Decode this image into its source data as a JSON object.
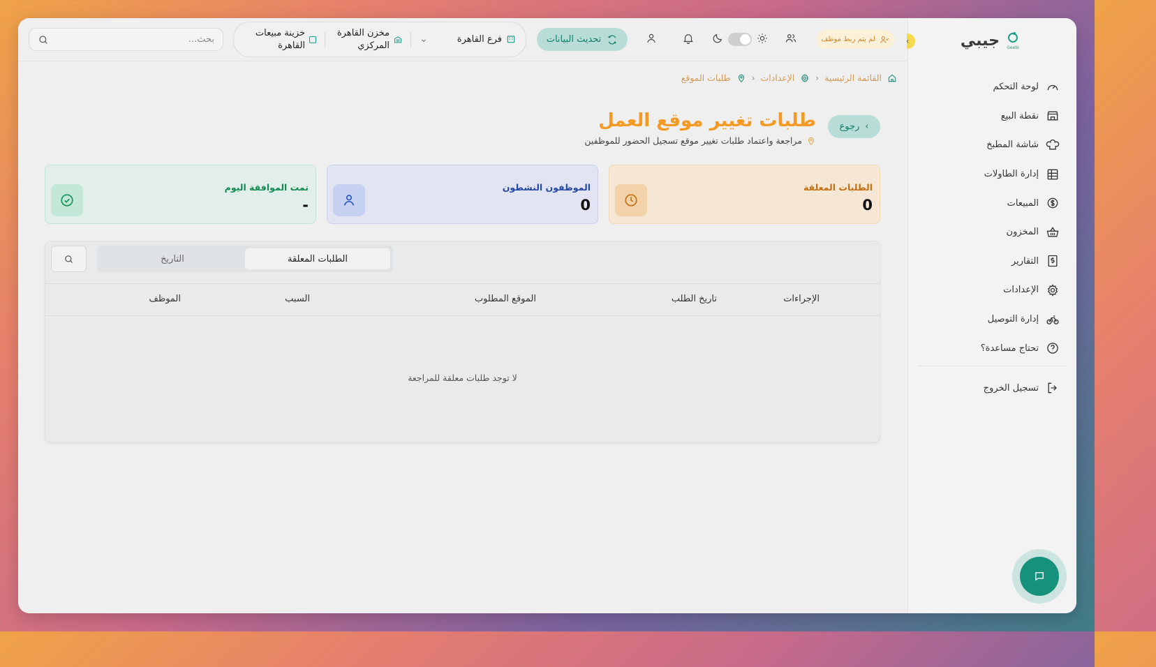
{
  "app": {
    "logo_text": "جيبي",
    "logo_sub": "Geebi"
  },
  "sidebar": {
    "items": [
      {
        "label": "لوحة التحكم",
        "icon": "gauge-icon"
      },
      {
        "label": "نقطة البيع",
        "icon": "store-icon"
      },
      {
        "label": "شاشة المطبخ",
        "icon": "chef-hat-icon"
      },
      {
        "label": "إدارة الطاولات",
        "icon": "table-grid-icon"
      },
      {
        "label": "المبيعات",
        "icon": "dollar-circle-icon"
      },
      {
        "label": "المخزون",
        "icon": "basket-icon"
      },
      {
        "label": "التقارير",
        "icon": "receipt-icon"
      },
      {
        "label": "الإعدادات",
        "icon": "gear-icon"
      },
      {
        "label": "إدارة التوصيل",
        "icon": "bicycle-icon"
      },
      {
        "label": "تحتاج مساعدة؟",
        "icon": "help-circle-icon"
      }
    ],
    "logout_label": "تسجيل الخروج"
  },
  "topbar": {
    "search_placeholder": "بحث...",
    "treasury_label": "خزينة مبيعات القاهرة",
    "warehouse_label": "مخزن القاهرة المركزي",
    "branch_label": "فرع القاهرة",
    "refresh_label": "تحديث البيانات",
    "unlinked_badge": "لم يتم ربط موظف"
  },
  "breadcrumb": {
    "home": "القائمة الرئيسية",
    "settings": "الإعدادات",
    "current": "طلبات الموقع"
  },
  "page": {
    "back_label": "رجوع",
    "title": "طلبات تغيير موقع العمل",
    "subtitle": "مراجعة واعتماد طلبات تغيير موقع تسجيل الحضور للموظفين"
  },
  "stats": {
    "pending": {
      "label": "الطلبات المعلقة",
      "value": "0"
    },
    "active": {
      "label": "الموظفون النشطون",
      "value": "0"
    },
    "approved": {
      "label": "تمت الموافقة اليوم",
      "value": "-"
    }
  },
  "panel": {
    "tabs": [
      "الطلبات المعلقة",
      "التاريخ"
    ],
    "active_tab": "الطلبات المعلقة",
    "columns": [
      "الإجراءات",
      "تاريخ الطلب",
      "الموقع المطلوب",
      "السبب",
      "الموظف"
    ],
    "empty_text": "لا توجد طلبات معلقة للمراجعة"
  },
  "colors": {
    "accent": "#f29a24",
    "primary": "#15917c",
    "pending": "#c46e12",
    "active": "#2347a6",
    "approved": "#128a52"
  }
}
